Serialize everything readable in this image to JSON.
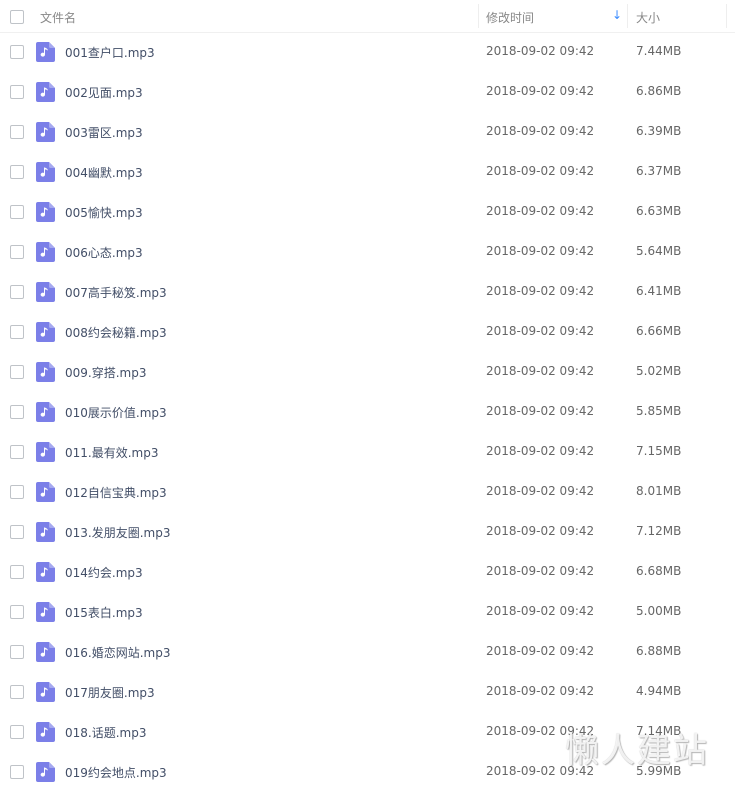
{
  "header": {
    "name_label": "文件名",
    "time_label": "修改时间",
    "size_label": "大小",
    "sort_indicator": "↓"
  },
  "colors": {
    "icon_bg": "#7b7fe8",
    "sort_accent": "#3b8cff"
  },
  "icon": "music-file-icon",
  "files": [
    {
      "name": "001查户口.mp3",
      "time": "2018-09-02 09:42",
      "size": "7.44MB"
    },
    {
      "name": "002见面.mp3",
      "time": "2018-09-02 09:42",
      "size": "6.86MB"
    },
    {
      "name": "003雷区.mp3",
      "time": "2018-09-02 09:42",
      "size": "6.39MB"
    },
    {
      "name": "004幽默.mp3",
      "time": "2018-09-02 09:42",
      "size": "6.37MB"
    },
    {
      "name": "005愉快.mp3",
      "time": "2018-09-02 09:42",
      "size": "6.63MB"
    },
    {
      "name": "006心态.mp3",
      "time": "2018-09-02 09:42",
      "size": "5.64MB"
    },
    {
      "name": "007高手秘笈.mp3",
      "time": "2018-09-02 09:42",
      "size": "6.41MB"
    },
    {
      "name": "008约会秘籍.mp3",
      "time": "2018-09-02 09:42",
      "size": "6.66MB"
    },
    {
      "name": "009.穿搭.mp3",
      "time": "2018-09-02 09:42",
      "size": "5.02MB"
    },
    {
      "name": "010展示价值.mp3",
      "time": "2018-09-02 09:42",
      "size": "5.85MB"
    },
    {
      "name": "011.最有效.mp3",
      "time": "2018-09-02 09:42",
      "size": "7.15MB"
    },
    {
      "name": "012自信宝典.mp3",
      "time": "2018-09-02 09:42",
      "size": "8.01MB"
    },
    {
      "name": "013.发朋友圈.mp3",
      "time": "2018-09-02 09:42",
      "size": "7.12MB"
    },
    {
      "name": "014约会.mp3",
      "time": "2018-09-02 09:42",
      "size": "6.68MB"
    },
    {
      "name": "015表白.mp3",
      "time": "2018-09-02 09:42",
      "size": "5.00MB"
    },
    {
      "name": "016.婚恋网站.mp3",
      "time": "2018-09-02 09:42",
      "size": "6.88MB"
    },
    {
      "name": "017朋友圈.mp3",
      "time": "2018-09-02 09:42",
      "size": "4.94MB"
    },
    {
      "name": "018.话题.mp3",
      "time": "2018-09-02 09:42",
      "size": "7.14MB"
    },
    {
      "name": "019约会地点.mp3",
      "time": "2018-09-02 09:42",
      "size": "5.99MB"
    }
  ],
  "watermark": "懒人建站"
}
